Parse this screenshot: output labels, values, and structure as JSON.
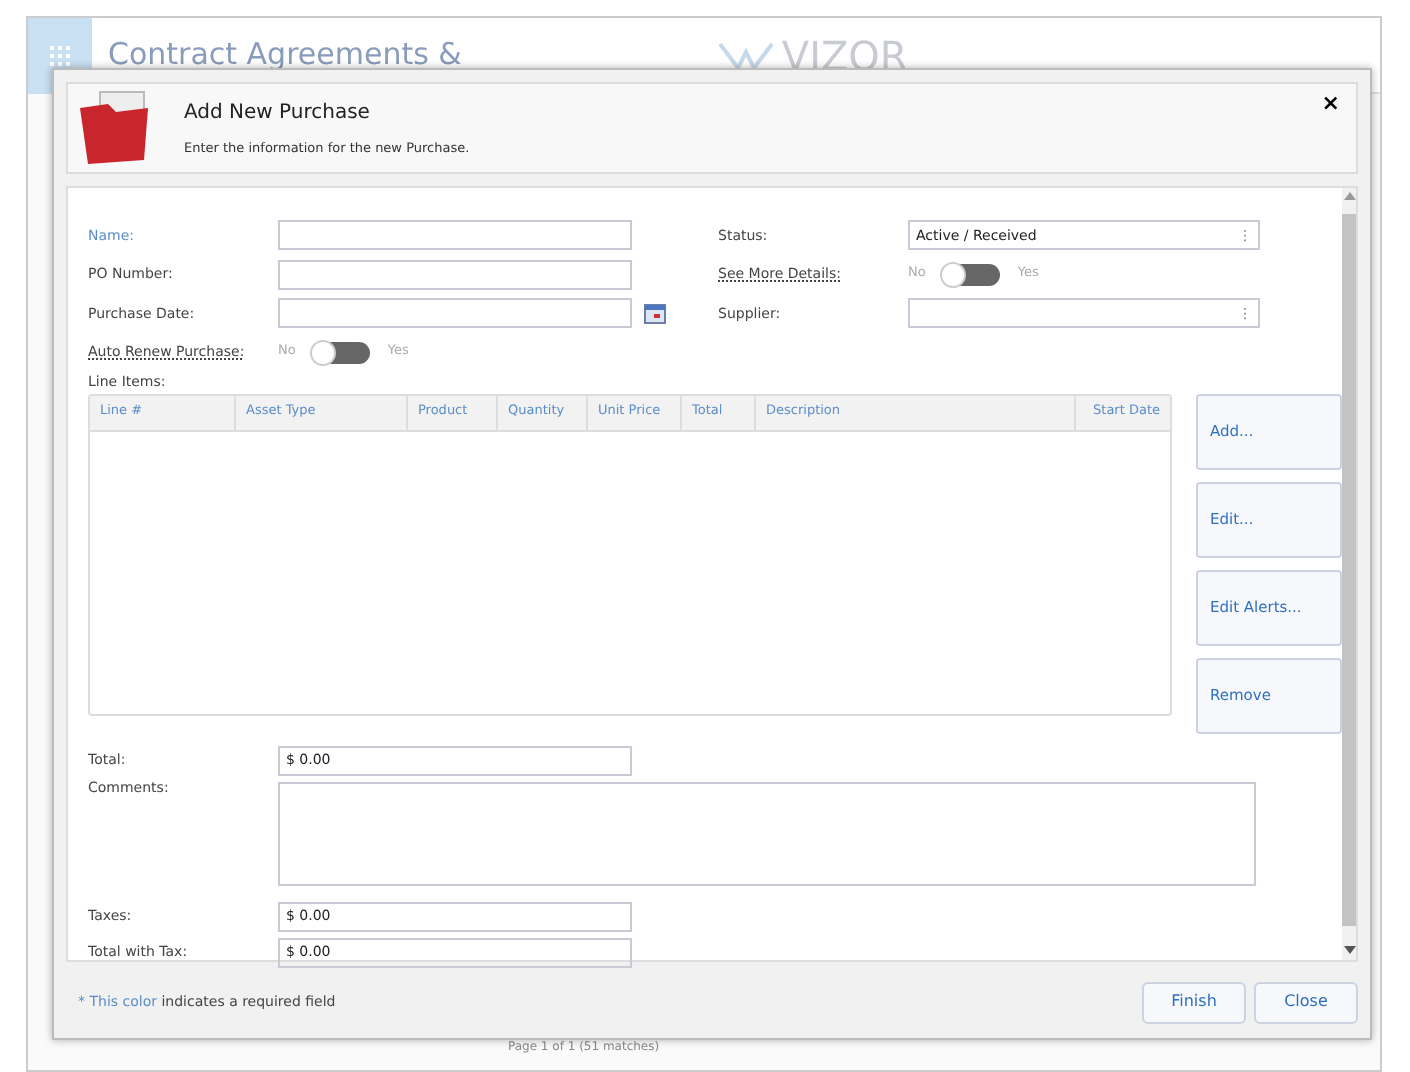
{
  "background": {
    "title": "Contract Agreements &",
    "logo": "VIZOR",
    "pager": "Page 1 of 1 (51 matches)"
  },
  "dialog": {
    "title": "Add New Purchase",
    "subtitle": "Enter the information for the new Purchase.",
    "close": "×"
  },
  "fields_left": [
    {
      "kind": "input",
      "label": "Name:",
      "required": true
    },
    {
      "kind": "input",
      "label": "PO Number:",
      "required": false
    },
    {
      "kind": "date",
      "label": "Purchase Date:",
      "required": false
    },
    {
      "kind": "toggle",
      "label": "Auto Renew Purchase:",
      "required": false,
      "off_text": "No",
      "on_text": "Yes",
      "on": false
    }
  ],
  "fields_right": [
    {
      "kind": "select",
      "label": "Status:",
      "value": "Active / Received",
      "handle": "⋮"
    },
    {
      "kind": "toggle",
      "label": "See More Details:",
      "off_text": "No",
      "on_text": "Yes",
      "on": false
    },
    {
      "kind": "select",
      "label": "Supplier:",
      "handle": "⋮"
    }
  ],
  "line_items": {
    "label": "Line Items:",
    "columns": [
      "Line #",
      "Asset Type",
      "Product",
      "Quantity",
      "Unit Price",
      "Total",
      "Description",
      "Start Date"
    ],
    "buttons": [
      "Add...",
      "Edit...",
      "Edit Alerts...",
      "Remove"
    ]
  },
  "fields_bottom": [
    {
      "kind": "input",
      "label": "Total:",
      "value": "$ 0.00"
    },
    {
      "kind": "textarea",
      "label": "Comments:"
    },
    {
      "kind": "input",
      "label": "Taxes:",
      "value": "$ 0.00"
    },
    {
      "kind": "input",
      "label": "Total with Tax:",
      "value": "$ 0.00"
    }
  ],
  "footer": {
    "required_marker": "* This color",
    "required_note": "indicates a required field",
    "buttons": [
      "Finish",
      "Close"
    ]
  }
}
